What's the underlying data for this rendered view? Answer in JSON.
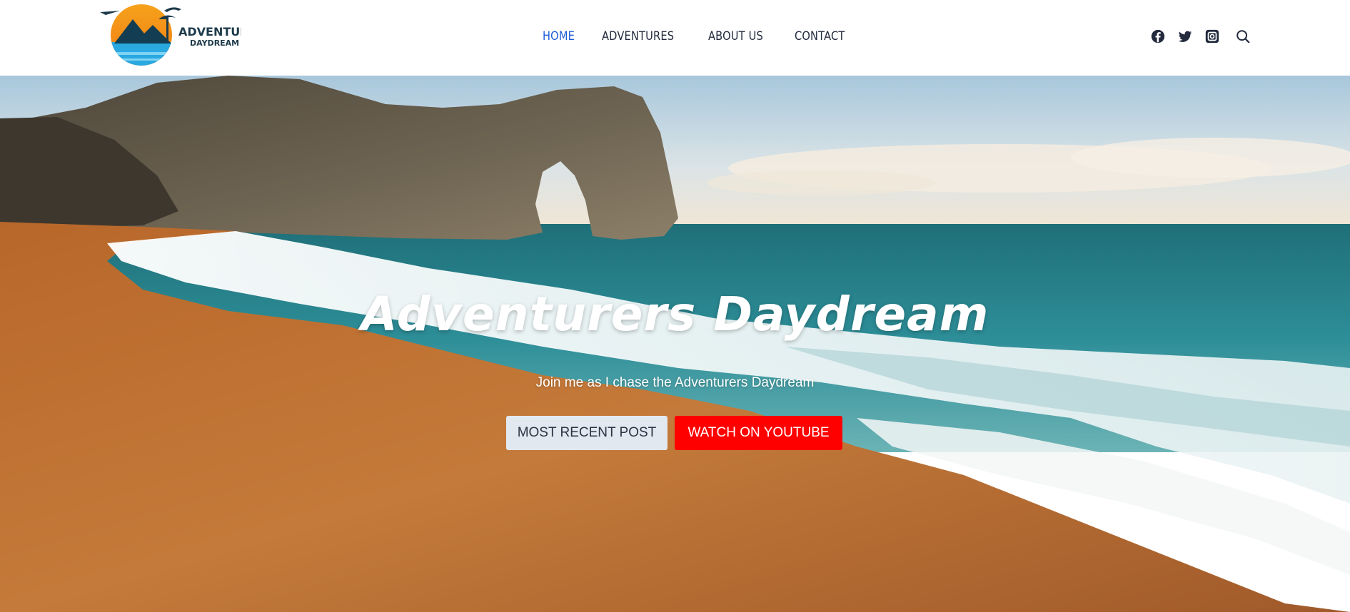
{
  "site": {
    "logo_text_top": "ADVENTURERS",
    "logo_text_bottom": "DAYDREAM"
  },
  "nav": {
    "items": [
      {
        "label": "HOME",
        "active": true
      },
      {
        "label": "ADVENTURES",
        "active": false
      },
      {
        "label": "ABOUT US",
        "active": false
      },
      {
        "label": "CONTACT",
        "active": false
      }
    ]
  },
  "header": {
    "icons": [
      "facebook-icon",
      "twitter-icon",
      "instagram-icon",
      "search-icon"
    ]
  },
  "hero": {
    "title": "Adventurers Daydream",
    "subtitle": "Join me as I chase the Adventurers Daydream",
    "buttons": {
      "recent": "MOST RECENT POST",
      "youtube": "WATCH ON YOUTUBE"
    }
  },
  "colors": {
    "nav_active": "#1f5fd6",
    "nav_text": "#232a3d",
    "youtube_button": "#ff0000",
    "secondary_button": "#e2e8f0"
  }
}
